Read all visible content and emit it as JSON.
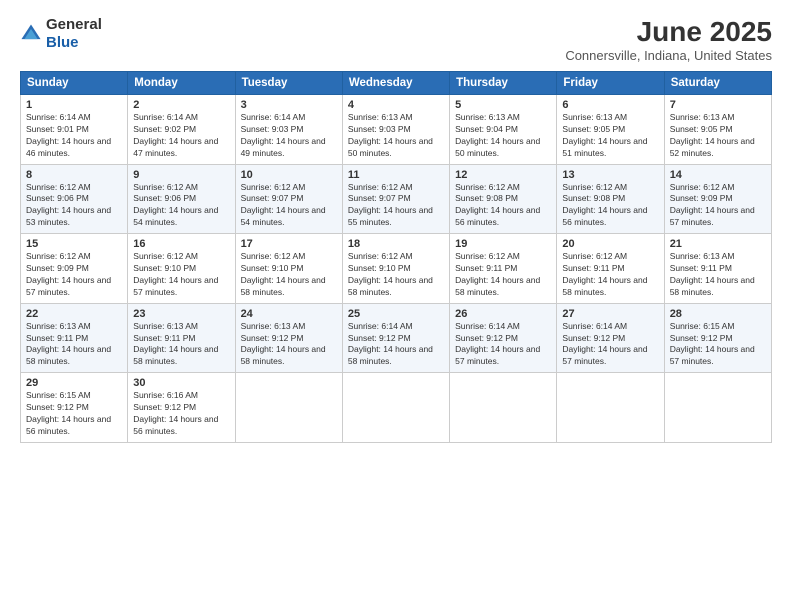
{
  "header": {
    "logo_line1": "General",
    "logo_line2": "Blue",
    "month_title": "June 2025",
    "location": "Connersville, Indiana, United States"
  },
  "days_of_week": [
    "Sunday",
    "Monday",
    "Tuesday",
    "Wednesday",
    "Thursday",
    "Friday",
    "Saturday"
  ],
  "weeks": [
    [
      {
        "day": 1,
        "sunrise": "6:14 AM",
        "sunset": "9:01 PM",
        "daylight": "14 hours and 46 minutes."
      },
      {
        "day": 2,
        "sunrise": "6:14 AM",
        "sunset": "9:02 PM",
        "daylight": "14 hours and 47 minutes."
      },
      {
        "day": 3,
        "sunrise": "6:14 AM",
        "sunset": "9:03 PM",
        "daylight": "14 hours and 49 minutes."
      },
      {
        "day": 4,
        "sunrise": "6:13 AM",
        "sunset": "9:03 PM",
        "daylight": "14 hours and 50 minutes."
      },
      {
        "day": 5,
        "sunrise": "6:13 AM",
        "sunset": "9:04 PM",
        "daylight": "14 hours and 50 minutes."
      },
      {
        "day": 6,
        "sunrise": "6:13 AM",
        "sunset": "9:05 PM",
        "daylight": "14 hours and 51 minutes."
      },
      {
        "day": 7,
        "sunrise": "6:13 AM",
        "sunset": "9:05 PM",
        "daylight": "14 hours and 52 minutes."
      }
    ],
    [
      {
        "day": 8,
        "sunrise": "6:12 AM",
        "sunset": "9:06 PM",
        "daylight": "14 hours and 53 minutes."
      },
      {
        "day": 9,
        "sunrise": "6:12 AM",
        "sunset": "9:06 PM",
        "daylight": "14 hours and 54 minutes."
      },
      {
        "day": 10,
        "sunrise": "6:12 AM",
        "sunset": "9:07 PM",
        "daylight": "14 hours and 54 minutes."
      },
      {
        "day": 11,
        "sunrise": "6:12 AM",
        "sunset": "9:07 PM",
        "daylight": "14 hours and 55 minutes."
      },
      {
        "day": 12,
        "sunrise": "6:12 AM",
        "sunset": "9:08 PM",
        "daylight": "14 hours and 56 minutes."
      },
      {
        "day": 13,
        "sunrise": "6:12 AM",
        "sunset": "9:08 PM",
        "daylight": "14 hours and 56 minutes."
      },
      {
        "day": 14,
        "sunrise": "6:12 AM",
        "sunset": "9:09 PM",
        "daylight": "14 hours and 57 minutes."
      }
    ],
    [
      {
        "day": 15,
        "sunrise": "6:12 AM",
        "sunset": "9:09 PM",
        "daylight": "14 hours and 57 minutes."
      },
      {
        "day": 16,
        "sunrise": "6:12 AM",
        "sunset": "9:10 PM",
        "daylight": "14 hours and 57 minutes."
      },
      {
        "day": 17,
        "sunrise": "6:12 AM",
        "sunset": "9:10 PM",
        "daylight": "14 hours and 58 minutes."
      },
      {
        "day": 18,
        "sunrise": "6:12 AM",
        "sunset": "9:10 PM",
        "daylight": "14 hours and 58 minutes."
      },
      {
        "day": 19,
        "sunrise": "6:12 AM",
        "sunset": "9:11 PM",
        "daylight": "14 hours and 58 minutes."
      },
      {
        "day": 20,
        "sunrise": "6:12 AM",
        "sunset": "9:11 PM",
        "daylight": "14 hours and 58 minutes."
      },
      {
        "day": 21,
        "sunrise": "6:13 AM",
        "sunset": "9:11 PM",
        "daylight": "14 hours and 58 minutes."
      }
    ],
    [
      {
        "day": 22,
        "sunrise": "6:13 AM",
        "sunset": "9:11 PM",
        "daylight": "14 hours and 58 minutes."
      },
      {
        "day": 23,
        "sunrise": "6:13 AM",
        "sunset": "9:11 PM",
        "daylight": "14 hours and 58 minutes."
      },
      {
        "day": 24,
        "sunrise": "6:13 AM",
        "sunset": "9:12 PM",
        "daylight": "14 hours and 58 minutes."
      },
      {
        "day": 25,
        "sunrise": "6:14 AM",
        "sunset": "9:12 PM",
        "daylight": "14 hours and 58 minutes."
      },
      {
        "day": 26,
        "sunrise": "6:14 AM",
        "sunset": "9:12 PM",
        "daylight": "14 hours and 57 minutes."
      },
      {
        "day": 27,
        "sunrise": "6:14 AM",
        "sunset": "9:12 PM",
        "daylight": "14 hours and 57 minutes."
      },
      {
        "day": 28,
        "sunrise": "6:15 AM",
        "sunset": "9:12 PM",
        "daylight": "14 hours and 57 minutes."
      }
    ],
    [
      {
        "day": 29,
        "sunrise": "6:15 AM",
        "sunset": "9:12 PM",
        "daylight": "14 hours and 56 minutes."
      },
      {
        "day": 30,
        "sunrise": "6:16 AM",
        "sunset": "9:12 PM",
        "daylight": "14 hours and 56 minutes."
      },
      null,
      null,
      null,
      null,
      null
    ]
  ]
}
